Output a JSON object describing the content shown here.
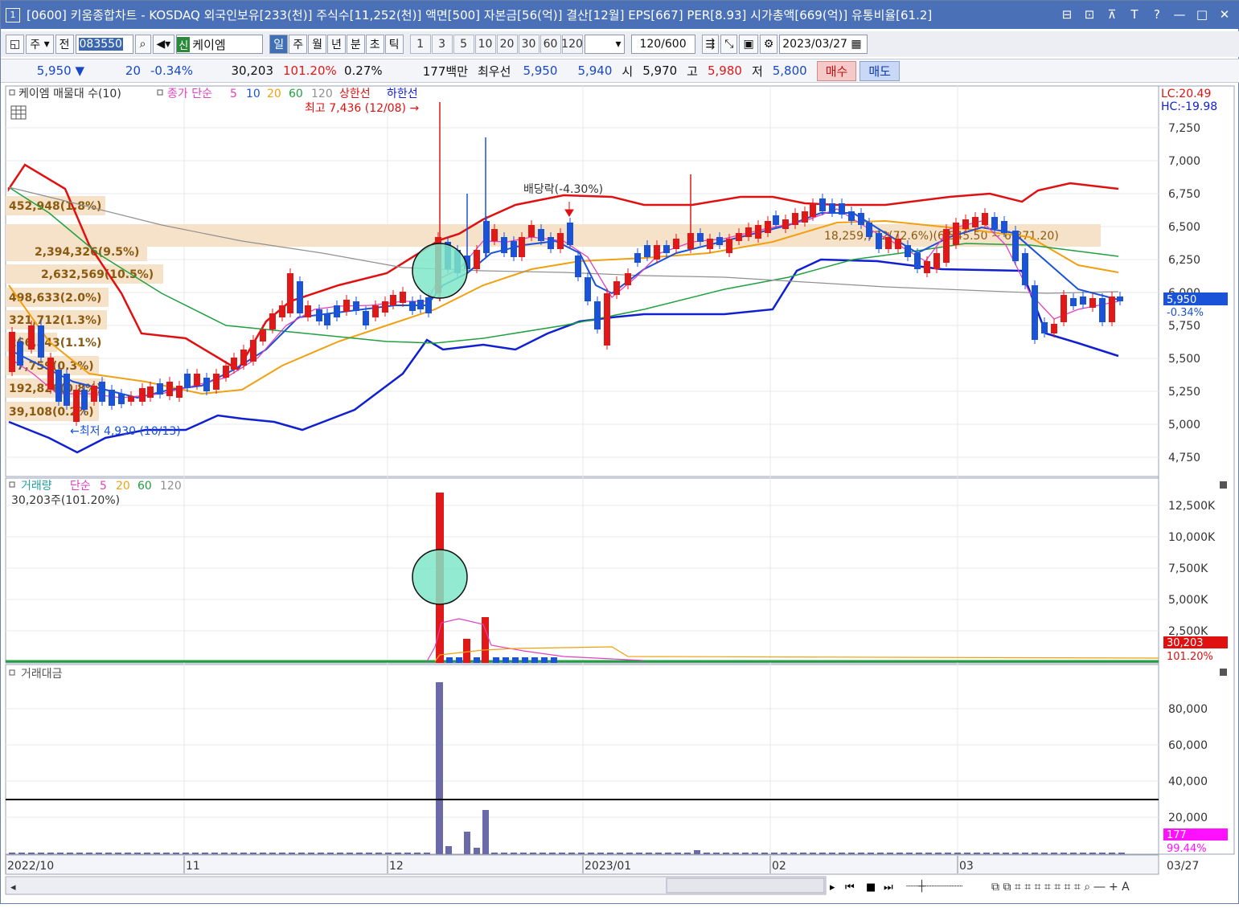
{
  "window": {
    "icon_label": "1",
    "title": "[0600] 키움종합차트 - KOSDAQ 외국인보유[233(천)] 주식수[11,252(천)] 액면[500] 자본금[56(억)] 결산[12월] EPS[667] PER[8.93] 시가총액[669(억)] 유통비율[61.2]",
    "controls": [
      "⊟",
      "⊡",
      "⊼",
      "T",
      "?",
      "—",
      "□",
      "✕"
    ]
  },
  "toolbar": {
    "market_select": "주",
    "prev_label": "전",
    "stock_code": "083550",
    "stock_badge": "신",
    "stock_name": "케이엠",
    "period_tabs": [
      "일",
      "주",
      "월",
      "년",
      "분",
      "초",
      "틱"
    ],
    "active_period": "일",
    "intervals": [
      "1",
      "3",
      "5",
      "10",
      "20",
      "30",
      "60",
      "120"
    ],
    "count": "120",
    "count_total": "/600",
    "date": "2023/03/27"
  },
  "quote": {
    "price": "5,950",
    "change_arrow": "▼",
    "change": "20",
    "change_pct": "-0.34%",
    "volume": "30,203",
    "volume_ratio": "101.20%",
    "turnover": "0.27%",
    "amount": "177백만",
    "best_label": "최우선",
    "ask": "5,950",
    "bid": "5,940",
    "open_label": "시",
    "open": "5,970",
    "high_label": "고",
    "high": "5,980",
    "low_label": "저",
    "low": "5,800",
    "buy": "매수",
    "sell": "매도"
  },
  "price_panel": {
    "legend_title": "케이엠 매물대 수(10)",
    "legend_ma": "종가 단순",
    "legend_periods": [
      "5",
      "10",
      "20",
      "60",
      "120"
    ],
    "legend_upper": "상한선",
    "legend_lower": "하한선",
    "lc": "LC:20.49",
    "hc": "HC:-19.98",
    "high_annotation": "최고 7,436 (12/08) →",
    "low_annotation": "←최저 4,930 (10/13)",
    "dividend_annotation": "배당락(-4.30%)",
    "current_price_tag": "5,950",
    "current_change_tag": "-0.34%",
    "y_ticks": [
      "7,250",
      "7,000",
      "6,750",
      "6,500",
      "6,250",
      "6,000",
      "5,750",
      "5,500",
      "5,250",
      "5,000",
      "4,750"
    ],
    "volume_profile": [
      {
        "label": "452,948(1.8%)"
      },
      {
        "label": "2,394,326(9.5%)"
      },
      {
        "label": "2,632,569(10.5%)"
      },
      {
        "label": "498,633(2.0%)"
      },
      {
        "label": "321,712(1.3%)"
      },
      {
        "label": "266,543(1.1%)"
      },
      {
        "label": "77,759(0.3%)"
      },
      {
        "label": "192,826(0.8%)"
      },
      {
        "label": "39,108(0.2%)"
      },
      {
        "label": "18,259,772(72.6%)(6,545.50 ~ 6,371.20)"
      }
    ]
  },
  "volume_panel": {
    "legend_title": "거래량",
    "legend_ma": "단순",
    "legend_periods": [
      "5",
      "20",
      "60",
      "120"
    ],
    "current_label": "30,203주(101.20%)",
    "y_ticks": [
      "12,500K",
      "10,000K",
      "7,500K",
      "5,000K",
      "2,500K"
    ],
    "tag_value": "30,203",
    "tag_pct": "101.20%"
  },
  "amount_panel": {
    "legend_title": "거래대금",
    "y_ticks": [
      "80,000",
      "60,000",
      "40,000",
      "20,000"
    ],
    "tag_value": "177",
    "tag_pct": "99.44%"
  },
  "x_axis": {
    "labels": [
      "2022/10",
      "11",
      "12",
      "2023/01",
      "02",
      "03"
    ],
    "end_label": "03/27"
  },
  "colors": {
    "up": "#e01818",
    "down": "#1a52d8",
    "upper_band": "#e01010",
    "lower_band": "#1020d0",
    "ma5": "#e040c0",
    "ma20": "#f0a010",
    "ma60": "#20a040",
    "ma120": "#909090",
    "profile": "#f5e2c8",
    "highlight": "#7fe6c8",
    "amount_bar": "#6a6aa8"
  }
}
